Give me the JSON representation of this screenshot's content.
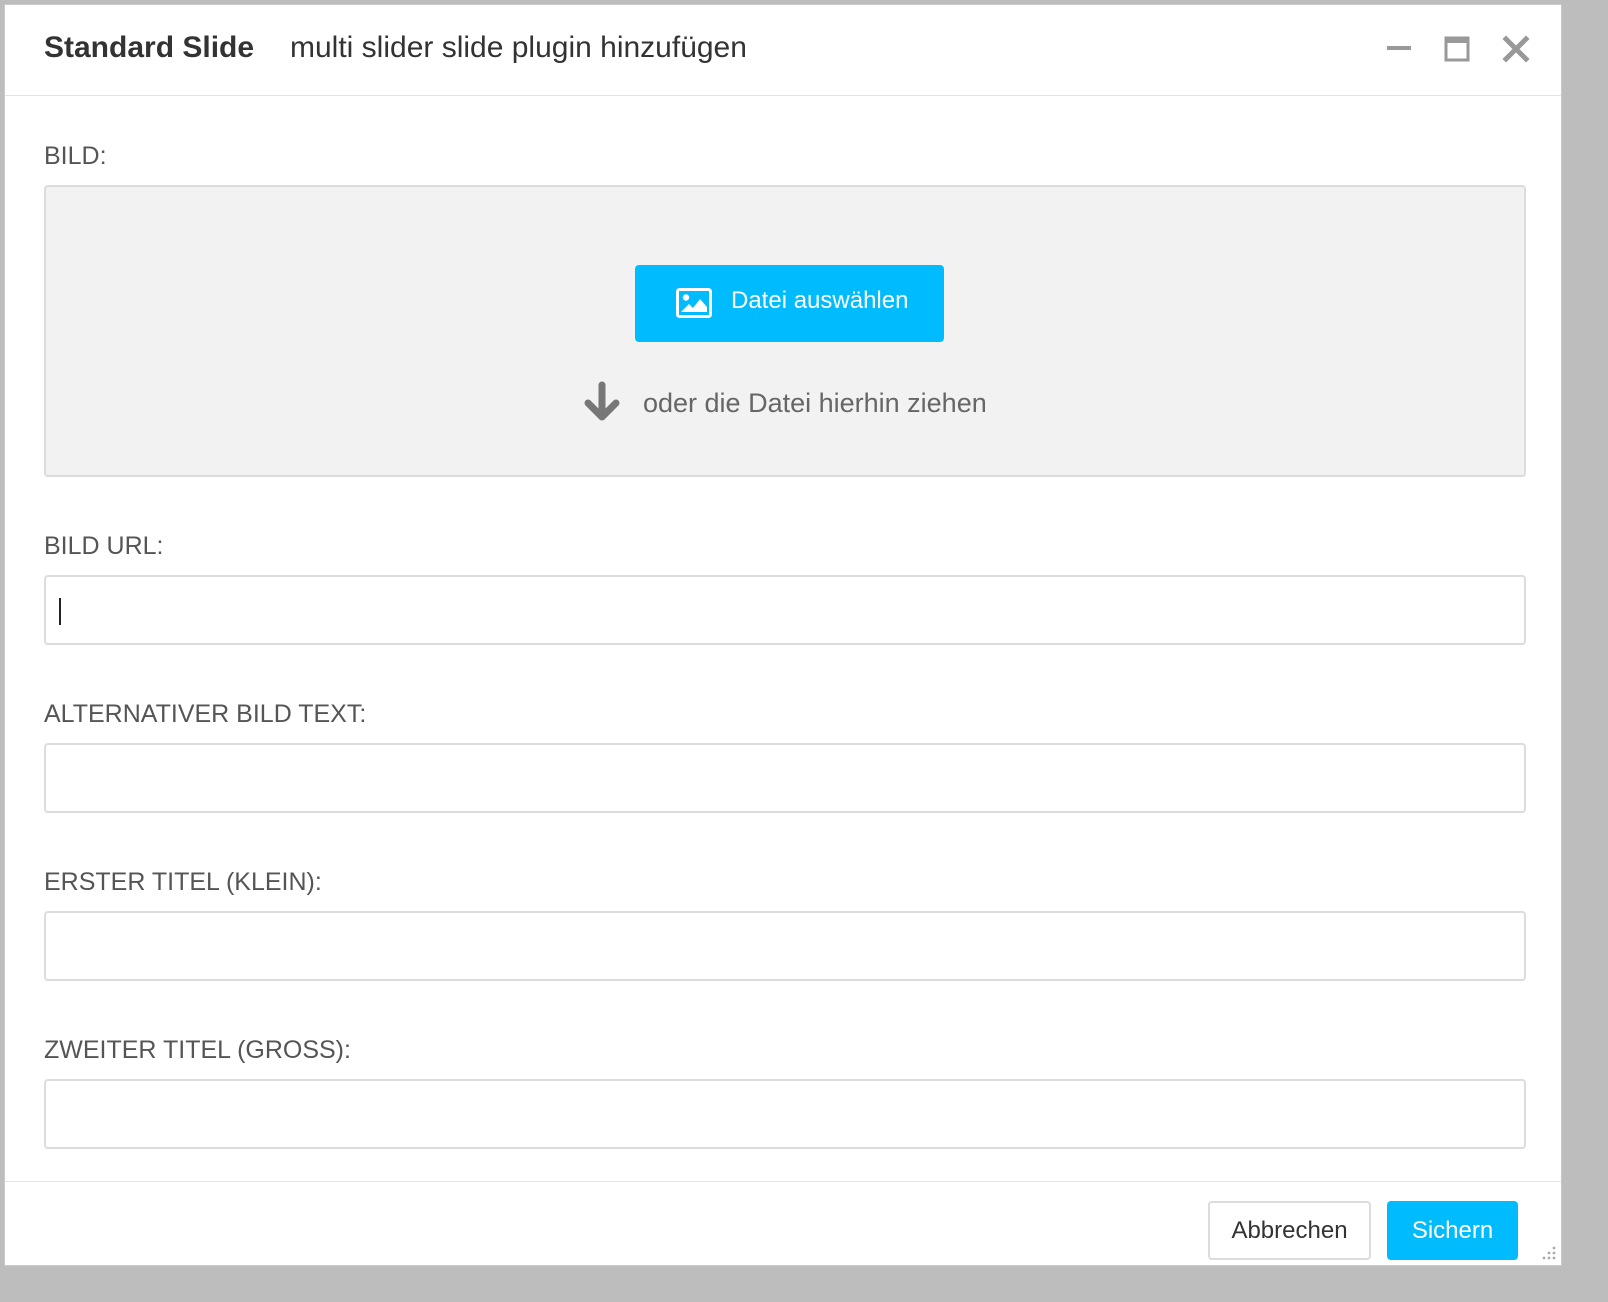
{
  "dialog": {
    "title": "Standard Slide",
    "subtitle": "multi slider slide plugin hinzufügen",
    "controls": {
      "minimize_icon": "minimize-icon",
      "maximize_icon": "maximize-icon",
      "close_icon": "close-icon"
    }
  },
  "form": {
    "image": {
      "label": "BILD:",
      "choose_button": "Datei auswählen",
      "choose_icon": "image-icon",
      "drop_icon": "arrow-down-icon",
      "drop_hint": "oder die Datei hierhin ziehen"
    },
    "image_url": {
      "label": "BILD URL:",
      "value": ""
    },
    "alt_text": {
      "label": "ALTERNATIVER BILD TEXT:",
      "value": ""
    },
    "first_title": {
      "label": "ERSTER TITEL (KLEIN):",
      "value": ""
    },
    "second_title": {
      "label": "ZWEITER TITEL (GROSS):",
      "value": ""
    }
  },
  "footer": {
    "cancel_label": "Abbrechen",
    "save_label": "Sichern"
  },
  "colors": {
    "accent": "#00bcff",
    "dropzone_bg": "#f2f2f2",
    "border": "#dcdcdc",
    "text": "#333333"
  }
}
